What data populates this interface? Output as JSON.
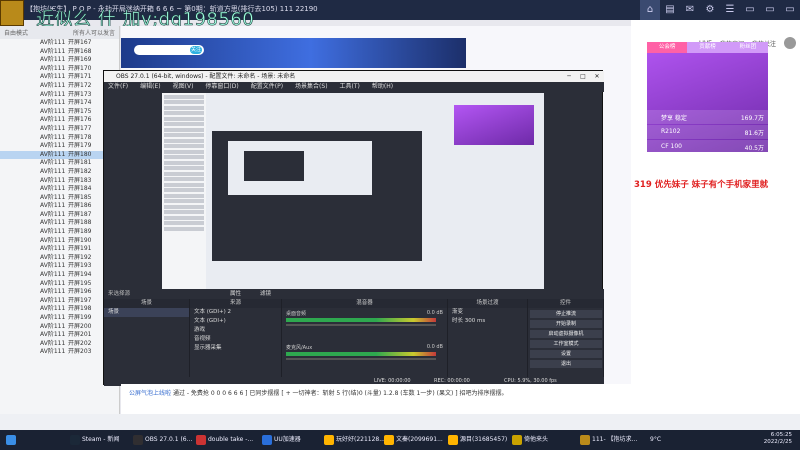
{
  "window": {
    "title": "【抱坊(Ѥ生】 P O P - 永劫开局迷纳开箱 6 6 6 ~ 第0期：斩道方思(排行去105) 111 22190"
  },
  "overlay_text": "近似么 什 加v;dq198560_",
  "header_tabs": [
    "⌂",
    "▤",
    "✉",
    "⚙",
    "☰",
    "▭",
    "▭",
    "▭"
  ],
  "left_panel": {
    "header_left": "自由模式",
    "header_right": "所有人可以发言",
    "rows": [
      {
        "v": "AV阶111",
        "r": "开屏167"
      },
      {
        "v": "AV阶111",
        "r": "开屏168"
      },
      {
        "v": "AV阶111",
        "r": "开屏169"
      },
      {
        "v": "AV阶111",
        "r": "开屏170"
      },
      {
        "v": "AV阶111",
        "r": "开屏171"
      },
      {
        "v": "AV阶111",
        "r": "开屏172"
      },
      {
        "v": "AV阶111",
        "r": "开屏173"
      },
      {
        "v": "AV阶111",
        "r": "开屏174"
      },
      {
        "v": "AV阶111",
        "r": "开屏175"
      },
      {
        "v": "AV阶111",
        "r": "开屏176"
      },
      {
        "v": "AV阶111",
        "r": "开屏177"
      },
      {
        "v": "AV阶111",
        "r": "开屏178"
      },
      {
        "v": "AV阶111",
        "r": "开屏179"
      },
      {
        "v": "AV阶111",
        "r": "开屏180"
      },
      {
        "v": "AV阶111",
        "r": "开屏181"
      },
      {
        "v": "AV阶111",
        "r": "开屏182"
      },
      {
        "v": "AV阶111",
        "r": "开屏183"
      },
      {
        "v": "AV阶111",
        "r": "开屏184"
      },
      {
        "v": "AV阶111",
        "r": "开屏185"
      },
      {
        "v": "AV阶111",
        "r": "开屏186"
      },
      {
        "v": "AV阶111",
        "r": "开屏187"
      },
      {
        "v": "AV阶111",
        "r": "开屏188"
      },
      {
        "v": "AV阶111",
        "r": "开屏189"
      },
      {
        "v": "AV阶111",
        "r": "开屏190"
      },
      {
        "v": "AV阶111",
        "r": "开屏191"
      },
      {
        "v": "AV阶111",
        "r": "开屏192"
      },
      {
        "v": "AV阶111",
        "r": "开屏193"
      },
      {
        "v": "AV阶111",
        "r": "开屏194"
      },
      {
        "v": "AV阶111",
        "r": "开屏195"
      },
      {
        "v": "AV阶111",
        "r": "开屏196"
      },
      {
        "v": "AV阶111",
        "r": "开屏197"
      },
      {
        "v": "AV阶111",
        "r": "开屏198"
      },
      {
        "v": "AV阶111",
        "r": "开屏199"
      },
      {
        "v": "AV阶111",
        "r": "开屏200"
      },
      {
        "v": "AV阶111",
        "r": "开屏201"
      },
      {
        "v": "AV阶111",
        "r": "开屏202"
      },
      {
        "v": "AV阶111",
        "r": "开屏203"
      }
    ]
  },
  "banner": {
    "pill_btn": "关注"
  },
  "right_panel": {
    "tabs": [
      "公会榜",
      "贡献榜",
      "粉丝团"
    ],
    "nav": [
      "LIVE",
      "我的房间",
      "我的关注"
    ],
    "rank_rows": [
      {
        "name": "梦享 稳定",
        "value": "169.7万"
      },
      {
        "name": "R2102",
        "value": "81.6万"
      },
      {
        "name": "CF 100",
        "value": "40.5万"
      }
    ],
    "message": "319 优先妹子 妹子有个手机家里就"
  },
  "obs": {
    "title": "OBS 27.0.1 (64-bit, windows) - 配置文件: 未命名 - 场景: 未命名",
    "menu": [
      "文件(F)",
      "编辑(E)",
      "视图(V)",
      "停靠窗口(D)",
      "配置文件(P)",
      "场景集合(S)",
      "工具(T)",
      "帮助(H)"
    ],
    "bottom_toolbar": {
      "label": "来选择源",
      "props": "属性",
      "filters": "滤镜"
    },
    "docks": {
      "scenes": {
        "title": "场景",
        "items": [
          "场景"
        ]
      },
      "sources": {
        "title": "来源",
        "items": [
          "文本 (GDI+) 2",
          "文本 (GDI+)",
          "游戏",
          "音视频",
          "显示器采集"
        ]
      },
      "mixer": {
        "title": "混音器",
        "ch1": "桌面音频",
        "ch1_db": "0.0 dB",
        "ch2": "麦克风/Aux",
        "ch2_db": "0.0 dB"
      },
      "transitions": {
        "title": "场景过渡",
        "type": "渐变",
        "dur_label": "时长",
        "dur": "300 ms"
      },
      "controls": {
        "title": "控件",
        "btns": [
          "停止推流",
          "开始录制",
          "启动虚拟摄像机",
          "工作室模式",
          "设置",
          "退出"
        ]
      }
    },
    "status": {
      "live": "LIVE: 00:00:00",
      "rec": "REC: 00:00:00",
      "cpu": "CPU: 5.9%, 30.00 fps"
    }
  },
  "chat": {
    "user": "公屏气泡上线啦",
    "text": "通过 - 免费抢 0 0 0  6 6 6 ] 已同步摆摆 [ + 一切神者：斩射 5 行(结)0 (斗量) 1.2.8 (车数 1一步) (果文) ] 招吧为排序摆摆。"
  },
  "taskbar": {
    "items": [
      {
        "label": "Steam - 新闻"
      },
      {
        "label": "OBS 27.0.1 (6..."
      },
      {
        "label": "double take -..."
      },
      {
        "label": "UU加速器"
      },
      {
        "label": "玩好好(221128..."
      },
      {
        "label": "文秦(2099691..."
      },
      {
        "label": "源目(31685457)"
      },
      {
        "label": "倚他来头"
      },
      {
        "label": "111- 【抱坊求..."
      }
    ],
    "tray_temp": "9°C",
    "time": "6:05:25",
    "date": "2022/2/25"
  }
}
